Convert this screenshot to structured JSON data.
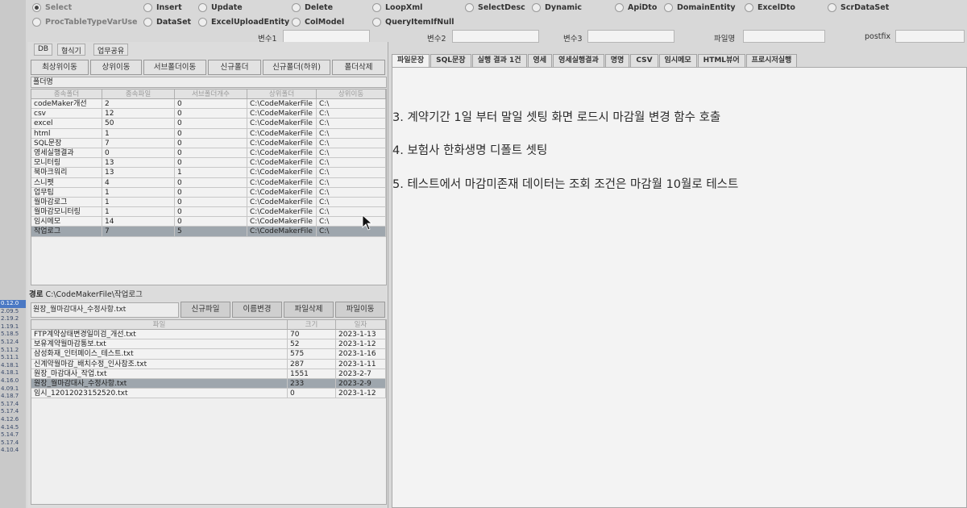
{
  "radio_row_1": [
    {
      "label": "Select",
      "checked": true
    },
    {
      "label": "Insert",
      "checked": false
    },
    {
      "label": "Update",
      "checked": false
    },
    {
      "label": "Delete",
      "checked": false
    },
    {
      "label": "LoopXml",
      "checked": false
    },
    {
      "label": "SelectDesc",
      "checked": false
    },
    {
      "label": "Dynamic",
      "checked": false
    },
    {
      "label": "ApiDto",
      "checked": false
    },
    {
      "label": "DomainEntity",
      "checked": false
    },
    {
      "label": "ExcelDto",
      "checked": false
    },
    {
      "label": "ScrDataSet",
      "checked": false
    }
  ],
  "radio_row_2": [
    {
      "label": "ProcTableTypeVarUse",
      "checked": false
    },
    {
      "label": "DataSet",
      "checked": false
    },
    {
      "label": "ExcelUploadEntity",
      "checked": false
    },
    {
      "label": "ColModel",
      "checked": false
    },
    {
      "label": "QueryItemIfNull",
      "checked": false
    }
  ],
  "vars": {
    "var1_label": "변수1",
    "var2_label": "변수2",
    "var3_label": "변수3",
    "filename_label": "파일명",
    "postfix_label": "postfix"
  },
  "left_tabs": [
    "DB",
    "형식기",
    "업무공유"
  ],
  "folder_buttons": [
    "최상위이동",
    "상위이동",
    "서브폴더이동",
    "신규폴더",
    "신규폴더(하위)",
    "폴더삭제"
  ],
  "folder_name_label": "폴더명",
  "folder_table": {
    "headers": [
      "종속폴더",
      "종속파일",
      "서브폴더개수",
      "상위폴더",
      "상위이동"
    ],
    "rows": [
      [
        "codeMaker개선",
        "2",
        "0",
        "C:\\CodeMakerFile",
        "C:\\"
      ],
      [
        "csv",
        "12",
        "0",
        "C:\\CodeMakerFile",
        "C:\\"
      ],
      [
        "excel",
        "50",
        "0",
        "C:\\CodeMakerFile",
        "C:\\"
      ],
      [
        "html",
        "1",
        "0",
        "C:\\CodeMakerFile",
        "C:\\"
      ],
      [
        "SQL문장",
        "7",
        "0",
        "C:\\CodeMakerFile",
        "C:\\"
      ],
      [
        "영세실행결과",
        "0",
        "0",
        "C:\\CodeMakerFile",
        "C:\\"
      ],
      [
        "모니터링",
        "13",
        "0",
        "C:\\CodeMakerFile",
        "C:\\"
      ],
      [
        "북마크워리",
        "13",
        "1",
        "C:\\CodeMakerFile",
        "C:\\"
      ],
      [
        "스니펫",
        "4",
        "0",
        "C:\\CodeMakerFile",
        "C:\\"
      ],
      [
        "업무팁",
        "1",
        "0",
        "C:\\CodeMakerFile",
        "C:\\"
      ],
      [
        "월마감로그",
        "1",
        "0",
        "C:\\CodeMakerFile",
        "C:\\"
      ],
      [
        "월마감모니터링",
        "1",
        "0",
        "C:\\CodeMakerFile",
        "C:\\"
      ],
      [
        "임시메모",
        "14",
        "0",
        "C:\\CodeMakerFile",
        "C:\\"
      ],
      [
        "작업로그",
        "7",
        "5",
        "C:\\CodeMakerFile",
        "C:\\"
      ]
    ],
    "selected_row": 13
  },
  "path_label": "경로",
  "path_value": "C:\\CodeMakerFile\\작업로그",
  "file_name_value": "원장_월마감대사_수정사항.txt",
  "file_buttons": [
    "신규파일",
    "이름변경",
    "파일삭제",
    "파일이동"
  ],
  "file_table": {
    "headers": [
      "파일",
      "크기",
      "일자"
    ],
    "rows": [
      [
        "FTP계약상태변경일미검_개선.txt",
        "70",
        "2023-1-13"
      ],
      [
        "보유계약월마감통보.txt",
        "52",
        "2023-1-12"
      ],
      [
        "삼성화재_인터페이스_테스트.txt",
        "575",
        "2023-1-16"
      ],
      [
        "신계약월마감_배치수정_인사참조.txt",
        "287",
        "2023-1-11"
      ],
      [
        "원장_마감대사_작업.txt",
        "1551",
        "2023-2-7"
      ],
      [
        "원장_월마감대사_수정사항.txt",
        "233",
        "2023-2-9"
      ],
      [
        "임시_12012023152520.txt",
        "0",
        "2023-1-12"
      ]
    ],
    "selected_row": 5
  },
  "right_tabs": [
    "파일문장",
    "SQL문장",
    "실행 결과 1건",
    "영세",
    "영세실행결과",
    "명명",
    "CSV",
    "임시메모",
    "HTML뷰어",
    "프로시저실행"
  ],
  "editor_lines": [
    "3. 계약기간 1일 부터 말일 셋팅 화면 로드시 마감월 변경 함수 호출",
    "4. 보험사 한화생명 디폴트 셋팅",
    "5. 테스트에서 마감미존재 데이터는 조회 조건은 마감월 10월로 테스트"
  ],
  "left_strip_numbers": [
    "0.12.0",
    "2.09.5",
    "2.19.2",
    "1.19.1",
    "5.18.5",
    "5.12.4",
    "5.11.2",
    "5.11.1",
    "4.18.1",
    "4.18.1",
    "4.16.0",
    "4.09.1",
    "4.18.7",
    "5.17.4",
    "5.17.4",
    "4.12.6",
    "4.14.5",
    "5.14.7",
    "5.17.4",
    "4.10.4"
  ]
}
